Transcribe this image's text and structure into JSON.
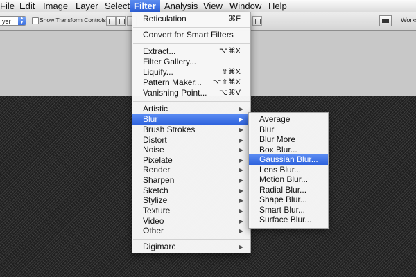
{
  "menubar": {
    "items": [
      {
        "label": "File",
        "active": false
      },
      {
        "label": "Edit",
        "active": false
      },
      {
        "label": "Image",
        "active": false
      },
      {
        "label": "Layer",
        "active": false
      },
      {
        "label": "Select",
        "active": false
      },
      {
        "label": "Filter",
        "active": true
      },
      {
        "label": "Analysis",
        "active": false
      },
      {
        "label": "View",
        "active": false
      },
      {
        "label": "Window",
        "active": false
      },
      {
        "label": "Help",
        "active": false
      }
    ]
  },
  "options_bar": {
    "layer_select_value": "yer",
    "show_transform_label": "Show Transform Controls",
    "workspace_label": "Works"
  },
  "filter_menu": {
    "last_filter": {
      "label": "Reticulation",
      "shortcut": "⌘F"
    },
    "convert_smart": "Convert for Smart Filters",
    "tools": [
      {
        "label": "Extract...",
        "shortcut": "⌥⌘X"
      },
      {
        "label": "Filter Gallery...",
        "shortcut": ""
      },
      {
        "label": "Liquify...",
        "shortcut": "⇧⌘X"
      },
      {
        "label": "Pattern Maker...",
        "shortcut": "⌥⇧⌘X"
      },
      {
        "label": "Vanishing Point...",
        "shortcut": "⌥⌘V"
      }
    ],
    "groups": [
      {
        "label": "Artistic",
        "active": false
      },
      {
        "label": "Blur",
        "active": true
      },
      {
        "label": "Brush Strokes",
        "active": false
      },
      {
        "label": "Distort",
        "active": false
      },
      {
        "label": "Noise",
        "active": false
      },
      {
        "label": "Pixelate",
        "active": false
      },
      {
        "label": "Render",
        "active": false
      },
      {
        "label": "Sharpen",
        "active": false
      },
      {
        "label": "Sketch",
        "active": false
      },
      {
        "label": "Stylize",
        "active": false
      },
      {
        "label": "Texture",
        "active": false
      },
      {
        "label": "Video",
        "active": false
      },
      {
        "label": "Other",
        "active": false
      }
    ],
    "digimarc": "Digimarc"
  },
  "blur_submenu": {
    "items": [
      {
        "label": "Average",
        "active": false
      },
      {
        "label": "Blur",
        "active": false
      },
      {
        "label": "Blur More",
        "active": false
      },
      {
        "label": "Box Blur...",
        "active": false
      },
      {
        "label": "Gaussian Blur...",
        "active": true
      },
      {
        "label": "Lens Blur...",
        "active": false
      },
      {
        "label": "Motion Blur...",
        "active": false
      },
      {
        "label": "Radial Blur...",
        "active": false
      },
      {
        "label": "Shape Blur...",
        "active": false
      },
      {
        "label": "Smart Blur...",
        "active": false
      },
      {
        "label": "Surface Blur...",
        "active": false
      }
    ]
  },
  "colors": {
    "highlight": "#3a6fe2",
    "canvas": "#1f1f1f"
  }
}
